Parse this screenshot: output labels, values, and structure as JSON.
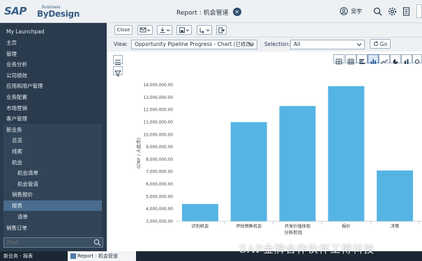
{
  "header": {
    "logo_sap": "SAP",
    "logo_business": "Business",
    "logo_bydesign": "ByDesign",
    "title": "Report : 机会管道",
    "user_name": "吴宇"
  },
  "sidebar": {
    "items": [
      {
        "label": "My Launchpad",
        "level": 1
      },
      {
        "label": "主页",
        "level": 1
      },
      {
        "label": "管理",
        "level": 1
      },
      {
        "label": "业务分析",
        "level": 1
      },
      {
        "label": "公司绩效",
        "level": 1
      },
      {
        "label": "应用和用户管理",
        "level": 1
      },
      {
        "label": "业务配置",
        "level": 1
      },
      {
        "label": "市场营销",
        "level": 1
      },
      {
        "label": "客户管理",
        "level": 1
      },
      {
        "label": "新业务",
        "level": 1
      },
      {
        "label": "总览",
        "level": 2
      },
      {
        "label": "线索",
        "level": 2
      },
      {
        "label": "机会",
        "level": 2
      },
      {
        "label": "机会清单",
        "level": 3
      },
      {
        "label": "机会管道",
        "level": 3
      },
      {
        "label": "销售报价",
        "level": 2
      },
      {
        "label": "报表",
        "level": 2
      },
      {
        "label": "清单",
        "level": 3
      },
      {
        "label": "销售订单",
        "level": 1
      }
    ],
    "active_item": "报表",
    "find_placeholder": "Find"
  },
  "toolbar": {
    "close_label": "Close"
  },
  "viewbar": {
    "view_label": "View:",
    "view_value": "Opportunity Pipeline Progress - Chart (已修改)",
    "selection_label": "Selection:",
    "selection_value": "All",
    "go_label": "Go"
  },
  "chart_data": {
    "type": "bar",
    "categories": [
      "识别机会",
      "评估销售机会",
      "开发价值体现",
      "报价",
      "决策"
    ],
    "values": [
      4400000,
      11000000,
      12300000,
      13900000,
      7100000
    ],
    "xlabel": "分析阶段",
    "ylabel": "(CNY / 人民币)",
    "ylim": [
      3000000,
      14000000
    ],
    "yticks": [
      3000000,
      4000000,
      5000000,
      6000000,
      7000000,
      8000000,
      9000000,
      10000000,
      11000000,
      12000000,
      13000000,
      14000000
    ],
    "ytick_labels": [
      "3,000,000.00",
      "4,000,000.00",
      "5,000,000.00",
      "6,000,000.00",
      "7,000,000.00",
      "8,000,000.00",
      "9,000,000.00",
      "10,000,000.00",
      "11,000,000.00",
      "12,000,000.00",
      "13,000,000.00",
      "14,000,000.00"
    ],
    "bar_color": "#56b4e4",
    "grid": false
  },
  "taskbar": {
    "left_text": "新业务 - 报表",
    "tab_text": "Report : 机会管道"
  },
  "watermark": "SAP金牌合作伙伴工博科技"
}
